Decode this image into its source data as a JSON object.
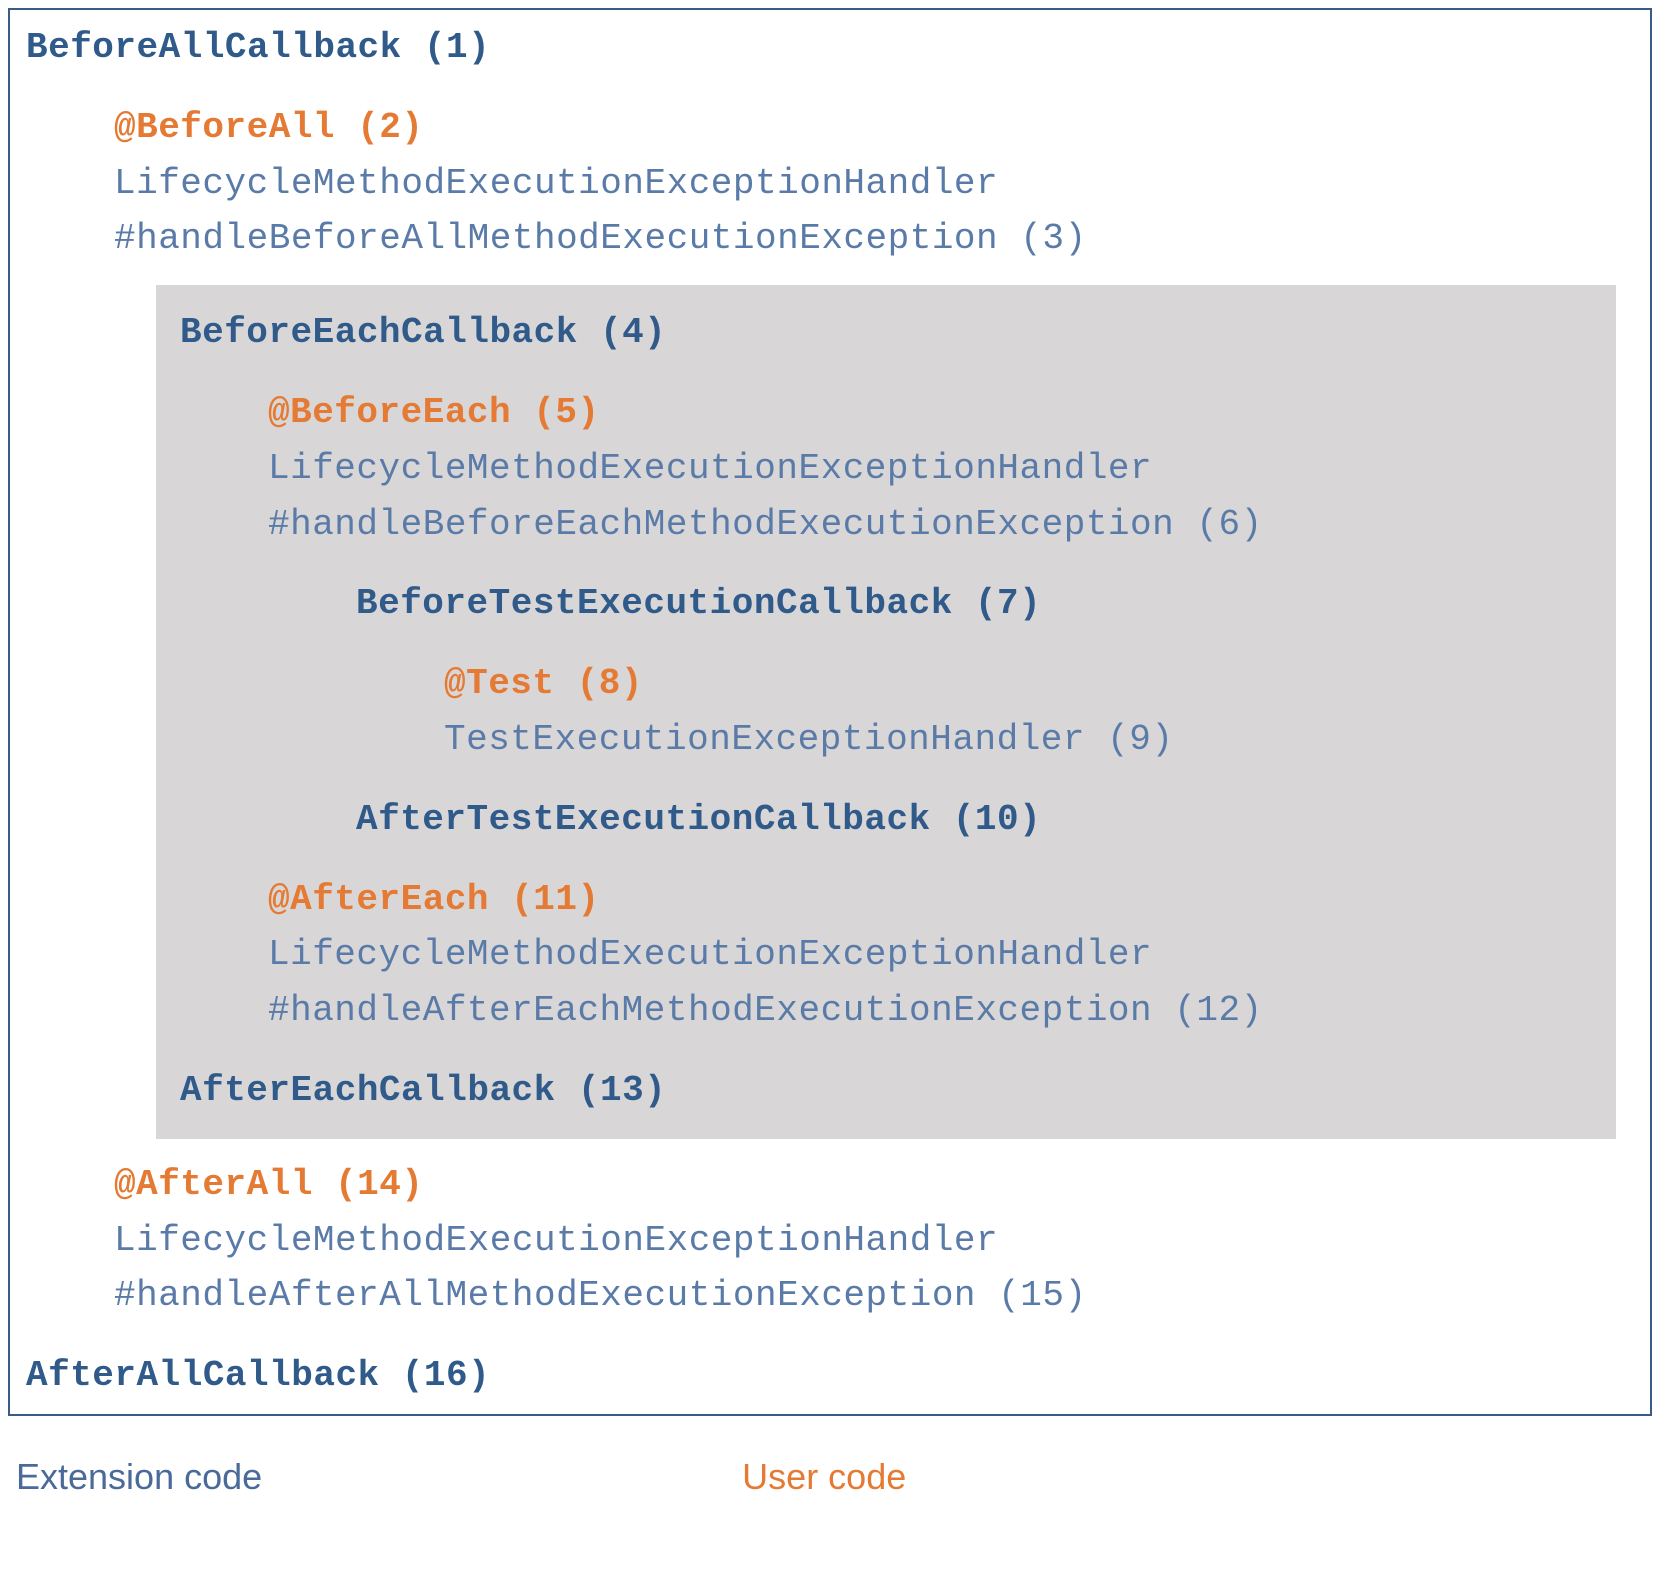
{
  "diagram": {
    "lines": {
      "l1": "BeforeAllCallback (1)",
      "l2": "@BeforeAll (2)",
      "l3a": "LifecycleMethodExecutionExceptionHandler",
      "l3b": "#handleBeforeAllMethodExecutionException (3)",
      "l4": "BeforeEachCallback (4)",
      "l5": "@BeforeEach (5)",
      "l6a": "LifecycleMethodExecutionExceptionHandler",
      "l6b": "#handleBeforeEachMethodExecutionException (6)",
      "l7": "BeforeTestExecutionCallback (7)",
      "l8": "@Test (8)",
      "l9": "TestExecutionExceptionHandler (9)",
      "l10": "AfterTestExecutionCallback (10)",
      "l11": "@AfterEach (11)",
      "l12a": "LifecycleMethodExecutionExceptionHandler",
      "l12b": "#handleAfterEachMethodExecutionException (12)",
      "l13": "AfterEachCallback (13)",
      "l14": "@AfterAll (14)",
      "l15a": "LifecycleMethodExecutionExceptionHandler",
      "l15b": "#handleAfterAllMethodExecutionException (15)",
      "l16": "AfterAllCallback (16)"
    }
  },
  "legend": {
    "extension": "Extension code",
    "user": "User code"
  }
}
